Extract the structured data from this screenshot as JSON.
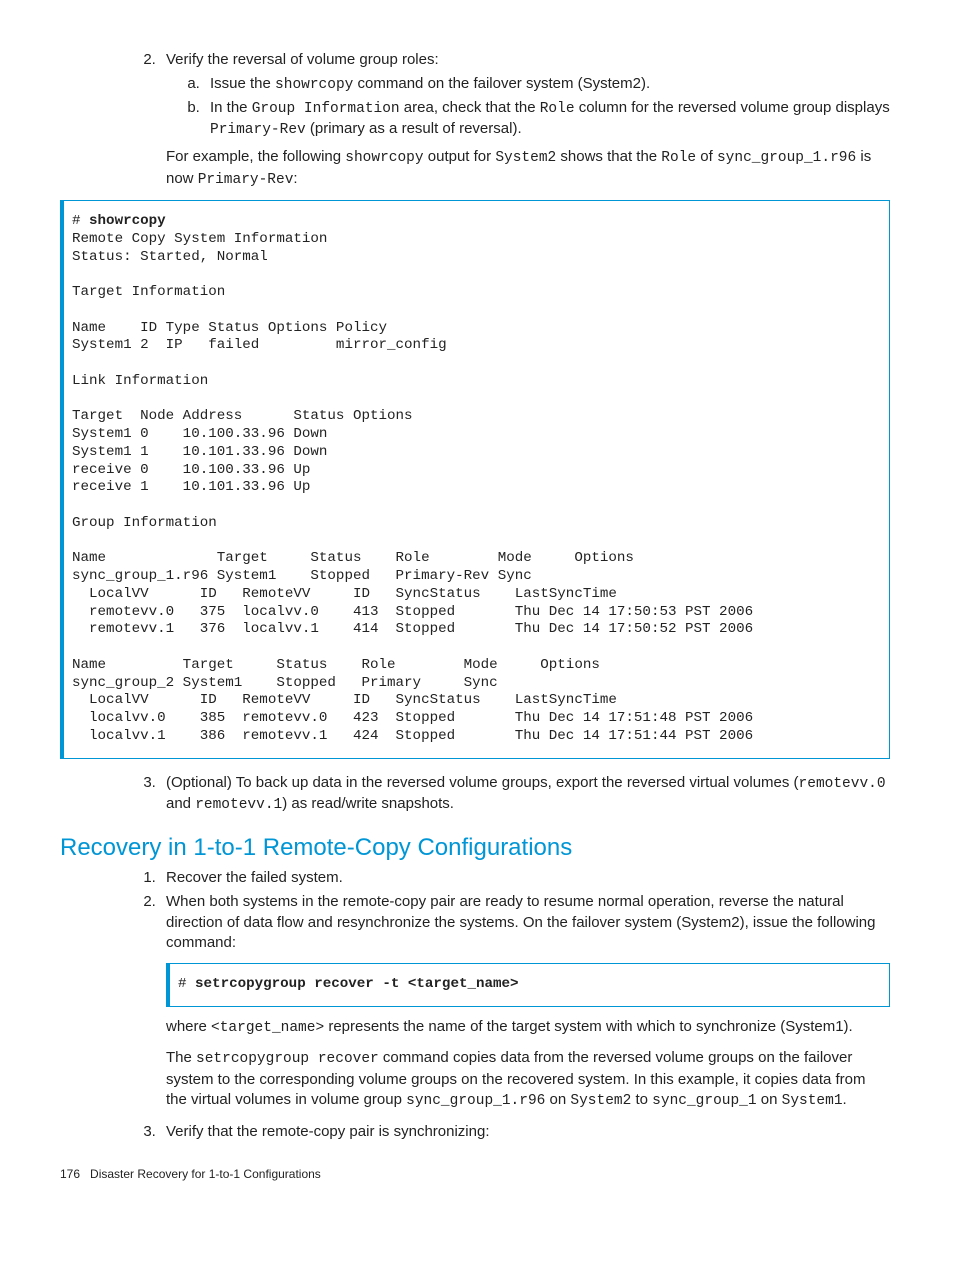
{
  "step2": {
    "text": "Verify the reversal of volume group roles:",
    "a_pre": "Issue the ",
    "a_code": "showrcopy",
    "a_post": " command on the failover system (System2).",
    "b_pre": "In the ",
    "b_code1": "Group Information",
    "b_mid": " area, check that the ",
    "b_code2": "Role",
    "b_post1": " column for the reversed volume group displays ",
    "b_code3": "Primary-Rev",
    "b_post2": " (primary as a result of reversal).",
    "example_1": "For example, the following ",
    "example_c1": "showrcopy",
    "example_2": " output for ",
    "example_c2": "System2",
    "example_3": " shows that the ",
    "example_c3": "Role",
    "example_4": " of ",
    "example_c4": "sync_group_1.r96",
    "example_5": " is now ",
    "example_c5": "Primary-Rev",
    "example_6": ":"
  },
  "codeblock1": {
    "prompt": "# ",
    "command": "showrcopy",
    "body": "\nRemote Copy System Information\nStatus: Started, Normal\n\nTarget Information\n\nName    ID Type Status Options Policy\nSystem1 2  IP   failed         mirror_config\n\nLink Information\n\nTarget  Node Address      Status Options\nSystem1 0    10.100.33.96 Down\nSystem1 1    10.101.33.96 Down\nreceive 0    10.100.33.96 Up\nreceive 1    10.101.33.96 Up\n\nGroup Information\n\nName             Target     Status    Role        Mode     Options\nsync_group_1.r96 System1    Stopped   Primary-Rev Sync\n  LocalVV      ID   RemoteVV     ID   SyncStatus    LastSyncTime\n  remotevv.0   375  localvv.0    413  Stopped       Thu Dec 14 17:50:53 PST 2006\n  remotevv.1   376  localvv.1    414  Stopped       Thu Dec 14 17:50:52 PST 2006\n\nName         Target     Status    Role        Mode     Options\nsync_group_2 System1    Stopped   Primary     Sync\n  LocalVV      ID   RemoteVV     ID   SyncStatus    LastSyncTime\n  localvv.0    385  remotevv.0   423  Stopped       Thu Dec 14 17:51:48 PST 2006\n  localvv.1    386  remotevv.1   424  Stopped       Thu Dec 14 17:51:44 PST 2006"
  },
  "step3": {
    "pre": "(Optional) To back up data in the reversed volume groups, export the reversed virtual volumes (",
    "c1": "remotevv.0",
    "mid": " and ",
    "c2": "remotevv.1",
    "post": ") as read/write snapshots."
  },
  "section2": {
    "heading": "Recovery in 1-to-1 Remote-Copy Configurations",
    "item1": "Recover the failed system.",
    "item2": "When both systems in the remote-copy pair are ready to resume normal operation, reverse the natural direction of data flow and resynchronize the systems. On the failover system (System2), issue the following command:",
    "cmd_prompt": "# ",
    "cmd": "setrcopygroup recover -t <target_name>",
    "where_1": "where ",
    "where_c1": "<target_name>",
    "where_2": " represents the name of the target system with which to synchronize (System1).",
    "desc_1": "The ",
    "desc_c1": "setrcopygroup recover",
    "desc_2": " command copies data from the reversed volume groups on the failover system to the corresponding volume groups on the recovered system. In this example, it copies data from the virtual volumes in volume group ",
    "desc_c2": "sync_group_1.r96",
    "desc_3": " on ",
    "desc_c3": "System2",
    "desc_4": " to ",
    "desc_c4": "sync_group_1",
    "desc_5": " on ",
    "desc_c5": "System1",
    "desc_6": ".",
    "item3": "Verify that the remote-copy pair is synchronizing:"
  },
  "footer": {
    "page": "176",
    "title": "Disaster Recovery for 1-to-1 Configurations"
  }
}
